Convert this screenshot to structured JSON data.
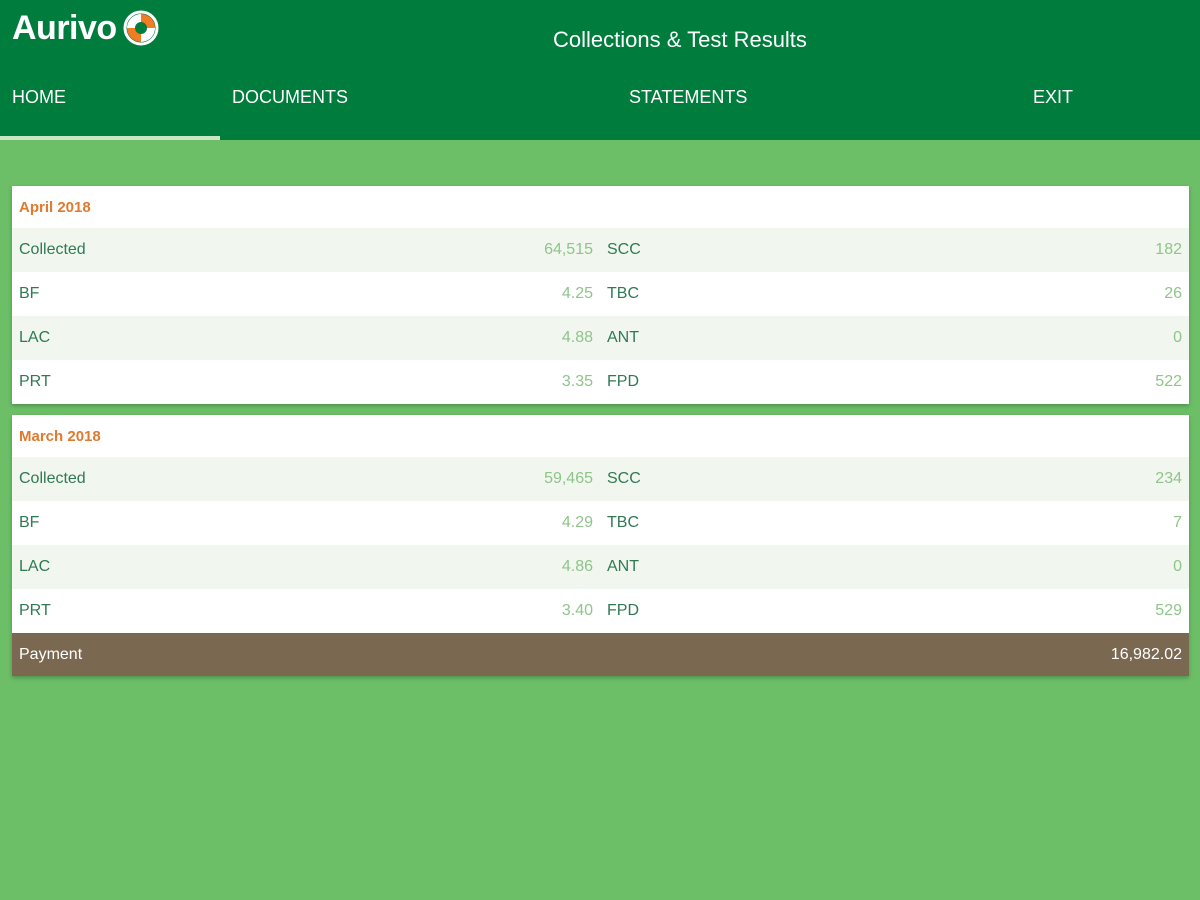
{
  "brand": {
    "name": "Aurivo",
    "mark_colors": [
      "#ffffff",
      "#f07d23"
    ]
  },
  "header": {
    "title": "Collections & Test Results"
  },
  "nav": {
    "home": "HOME",
    "documents": "DOCUMENTS",
    "statements": "STATEMENTS",
    "exit": "EXIT",
    "active": "HOME"
  },
  "colors": {
    "header_bg": "#007c3d",
    "page_bg": "#6cbf67",
    "month_label": "#e07a2e",
    "payment_bar": "#7a6851"
  },
  "periods": [
    {
      "month": "April 2018",
      "rows": [
        {
          "left_label": "Collected",
          "left_value": "64,515",
          "right_label": "SCC",
          "right_value": "182"
        },
        {
          "left_label": "BF",
          "left_value": "4.25",
          "right_label": "TBC",
          "right_value": "26"
        },
        {
          "left_label": "LAC",
          "left_value": "4.88",
          "right_label": "ANT",
          "right_value": "0"
        },
        {
          "left_label": "PRT",
          "left_value": "3.35",
          "right_label": "FPD",
          "right_value": "522"
        }
      ]
    },
    {
      "month": "March 2018",
      "rows": [
        {
          "left_label": "Collected",
          "left_value": "59,465",
          "right_label": "SCC",
          "right_value": "234"
        },
        {
          "left_label": "BF",
          "left_value": "4.29",
          "right_label": "TBC",
          "right_value": "7"
        },
        {
          "left_label": "LAC",
          "left_value": "4.86",
          "right_label": "ANT",
          "right_value": "0"
        },
        {
          "left_label": "PRT",
          "left_value": "3.40",
          "right_label": "FPD",
          "right_value": "529"
        }
      ],
      "payment": {
        "label": "Payment",
        "value": "16,982.02"
      }
    }
  ]
}
